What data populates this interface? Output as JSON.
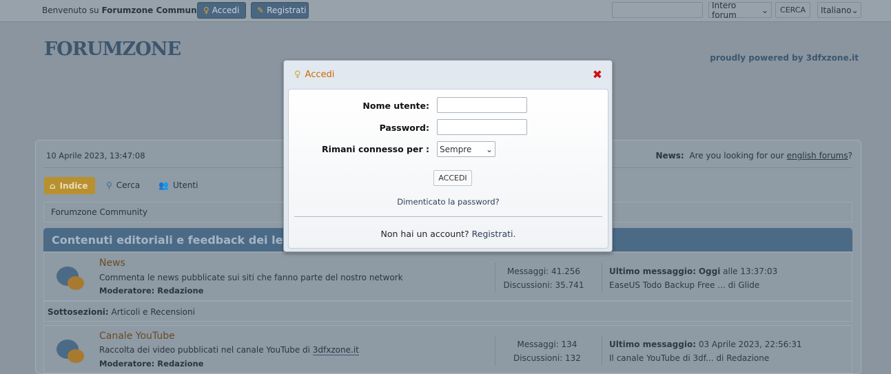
{
  "topbar": {
    "welcome_prefix": "Benvenuto su ",
    "welcome_site": "Forumzone Community",
    "welcome_suffix": ".",
    "login_label": "Accedi",
    "register_label": "Registrati",
    "search_value": "",
    "search_scope": "Intero forum",
    "search_button": "CERCA",
    "language": "Italiano"
  },
  "header": {
    "logo": "FORUMZONE",
    "tagline": "proudly powered by 3dfxzone.it"
  },
  "info": {
    "datetime": "10 Aprile 2023, 13:47:08",
    "news_label": "News:",
    "news_text": "Are you looking for our ",
    "news_link": "english forums",
    "news_end": "?"
  },
  "nav": [
    {
      "label": "Indice",
      "icon": "home-icon",
      "active": true
    },
    {
      "label": "Cerca",
      "icon": "search-icon"
    },
    {
      "label": "Utenti",
      "icon": "users-icon"
    }
  ],
  "breadcrumb": "Forumzone Community",
  "category": "Contenuti editoriali e feedback dei lettori",
  "forums": [
    {
      "title": "News",
      "desc": "Commenta le news pubblicate sui siti che fanno parte del nostro network",
      "desc_link": "",
      "mod_label": "Moderatore:",
      "mod": "Redazione",
      "messages": "Messaggi: 41.256",
      "topics": "Discussioni: 35.741",
      "last_label": "Ultimo messaggio:",
      "last_when_bold": "Oggi",
      "last_when": " alle 13:37:03",
      "last_post": "EaseUS Todo Backup Free ... di Glide"
    },
    {
      "title": "Canale YouTube",
      "desc": "Raccolta dei video pubblicati nel canale YouTube di ",
      "desc_link": "3dfxzone.it",
      "mod_label": "Moderatore:",
      "mod": "Redazione",
      "messages": "Messaggi: 134",
      "topics": "Discussioni: 132",
      "last_label": "Ultimo messaggio:",
      "last_when_bold": "",
      "last_when": " 03 Aprile 2023, 22:56:31",
      "last_post": "Il canale YouTube di 3df... di Redazione"
    }
  ],
  "subsections": {
    "label": "Sottosezioni:",
    "items": "Articoli e Recensioni"
  },
  "modal": {
    "title": "Accedi",
    "username_label": "Nome utente:",
    "username_value": "",
    "password_label": "Password:",
    "password_value": "",
    "remember_label": "Rimani connesso per :",
    "remember_value": "Sempre",
    "submit": "ACCEDI",
    "forgot": "Dimenticato la password?",
    "no_account": "Non hai un account? ",
    "register": "Registrati."
  },
  "colors": {
    "accent": "#4b6a86",
    "active_nav": "#b8912e",
    "title_link": "#c96a00",
    "close": "#cc1111"
  }
}
